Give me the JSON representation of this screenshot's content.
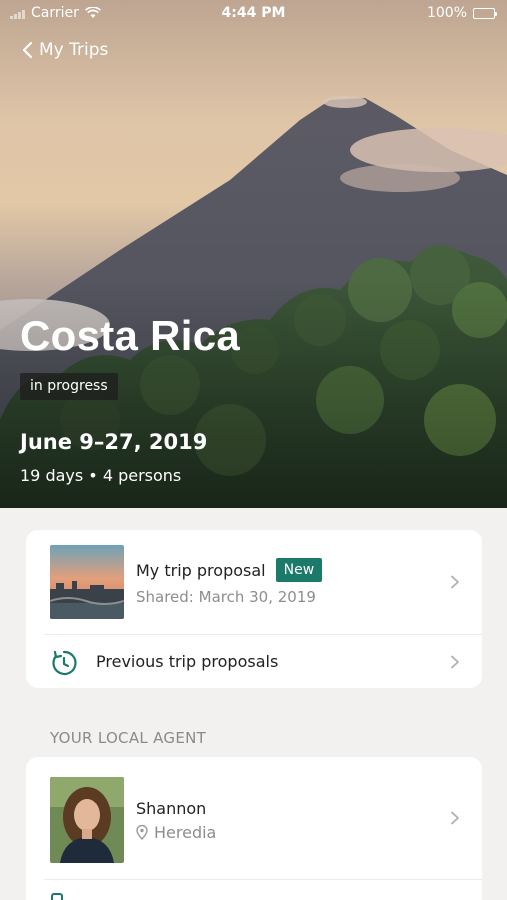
{
  "status_bar": {
    "carrier": "Carrier",
    "time": "4:44 PM",
    "battery": "100%",
    "battery_level": 1.0
  },
  "nav": {
    "back_label": "My Trips",
    "back_icon": "chevron-left-icon"
  },
  "trip": {
    "destination": "Costa Rica",
    "status": "in progress",
    "dates": "June 9–27, 2019",
    "summary": "19 days • 4 persons"
  },
  "proposals": {
    "latest": {
      "title": "My trip proposal",
      "badge": "New",
      "shared": "Shared: March 30, 2019"
    },
    "previous_label": "Previous trip proposals",
    "previous_icon": "history-icon"
  },
  "agent_section": {
    "heading": "YOUR LOCAL AGENT",
    "agent": {
      "name": "Shannon",
      "location": "Heredia",
      "location_icon": "map-pin-icon"
    }
  },
  "colors": {
    "accent": "#1c7a6a",
    "background": "#f2f1f0",
    "card": "#ffffff",
    "muted_text": "#8d8d8d"
  }
}
